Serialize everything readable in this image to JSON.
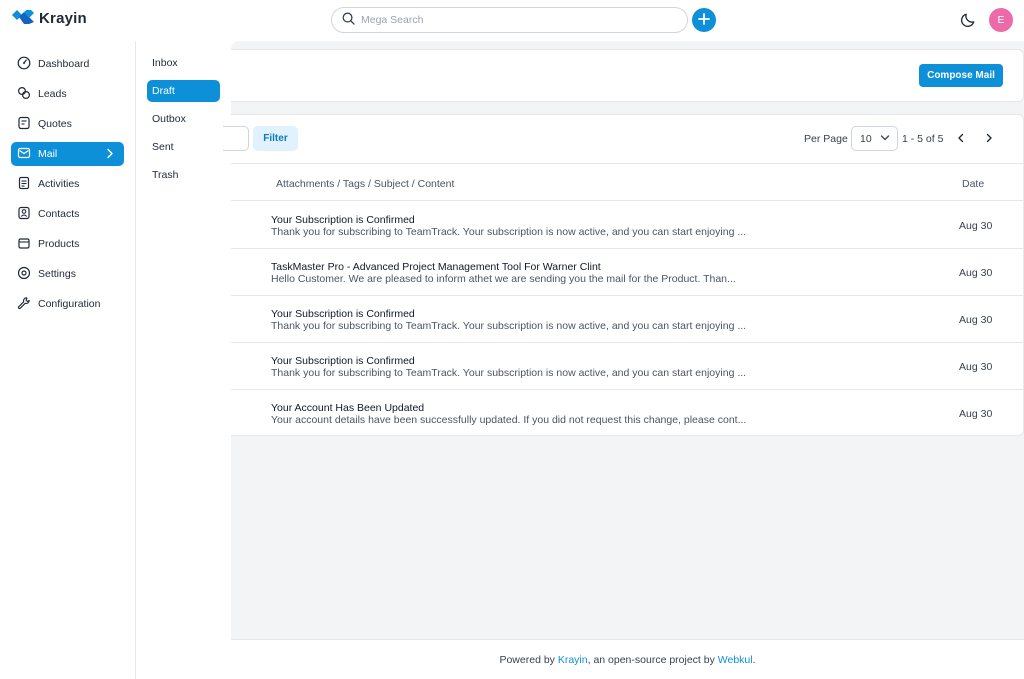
{
  "header": {
    "brand": "Krayin",
    "search_placeholder": "Mega Search",
    "user_initial": "E",
    "icons": [
      "krayin-logo-icon",
      "search-icon",
      "plus-icon",
      "moon-icon"
    ]
  },
  "sidebar": {
    "items": [
      {
        "label": "Dashboard",
        "icon": "dashboard-icon"
      },
      {
        "label": "Leads",
        "icon": "leads-icon"
      },
      {
        "label": "Quotes",
        "icon": "quotes-icon"
      },
      {
        "label": "Mail",
        "icon": "mail-icon",
        "active": true
      },
      {
        "label": "Activities",
        "icon": "activities-icon"
      },
      {
        "label": "Contacts",
        "icon": "contacts-icon"
      },
      {
        "label": "Products",
        "icon": "products-icon"
      },
      {
        "label": "Settings",
        "icon": "settings-icon"
      },
      {
        "label": "Configuration",
        "icon": "configuration-icon"
      }
    ]
  },
  "mail_nav": {
    "items": [
      {
        "label": "Inbox"
      },
      {
        "label": "Draft",
        "active": true
      },
      {
        "label": "Outbox"
      },
      {
        "label": "Sent"
      },
      {
        "label": "Trash"
      }
    ]
  },
  "toolbar": {
    "compose_label": "Compose Mail",
    "filter_label": "Filter",
    "per_page_label": "Per Page",
    "per_page_value": "10",
    "page_info": "1 - 5 of 5"
  },
  "table": {
    "columns": {
      "subject": "Attachments / Tags / Subject / Content",
      "date": "Date"
    },
    "rows": [
      {
        "subject": "Your Subscription is Confirmed",
        "preview": "Thank you for subscribing to TeamTrack. Your subscription is now active, and you can start enjoying ...",
        "date": "Aug 30"
      },
      {
        "subject": "TaskMaster Pro - Advanced Project Management Tool For Warner Clint",
        "preview": "Hello Customer. We are pleased to inform athet we are sending you the mail for the Product. Than...",
        "date": "Aug 30"
      },
      {
        "subject": "Your Subscription is Confirmed",
        "preview": "Thank you for subscribing to TeamTrack. Your subscription is now active, and you can start enjoying ...",
        "date": "Aug 30"
      },
      {
        "subject": "Your Subscription is Confirmed",
        "preview": "Thank you for subscribing to TeamTrack. Your subscription is now active, and you can start enjoying ...",
        "date": "Aug 30"
      },
      {
        "subject": "Your Account Has Been Updated",
        "preview": "Your account details have been successfully updated. If you did not request this change, please cont...",
        "date": "Aug 30"
      }
    ]
  },
  "footer": {
    "prefix": "Powered by ",
    "link1": "Krayin",
    "middle": ", an open-source project by ",
    "link2": "Webkul",
    "suffix": "."
  },
  "colors": {
    "accent": "#0e90d9",
    "avatar": "#ec6aa8",
    "filter_bg": "#e0f2fe"
  }
}
